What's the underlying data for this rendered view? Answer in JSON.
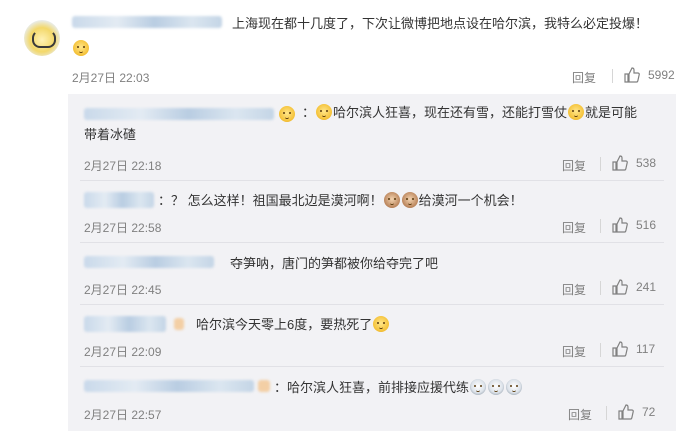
{
  "main_comment": {
    "text": "上海现在都十几度了，下次让微博把地点设在哈尔滨，我特么必定投爆！",
    "time": "2月27日 22:03",
    "reply_label": "回复",
    "likes": "5992"
  },
  "replies": [
    {
      "prefix": "：",
      "text_a": "哈尔滨人狂喜，现在还有雪，还能打雪仗",
      "text_b": "就是可能",
      "text_line2": "带着冰碴",
      "time": "2月27日 22:18",
      "reply_label": "回复",
      "likes": "538"
    },
    {
      "prefix": "：",
      "text_a": "？ 怎么这样！祖国最北边是漠河啊！",
      "text_b": "给漠河一个机会！",
      "time": "2月27日 22:58",
      "reply_label": "回复",
      "likes": "516"
    },
    {
      "text": "夺笋呐，唐门的笋都被你给夺完了吧",
      "time": "2月27日 22:45",
      "reply_label": "回复",
      "likes": "241"
    },
    {
      "text": "哈尔滨今天零上6度，要热死了",
      "time": "2月27日 22:09",
      "reply_label": "回复",
      "likes": "117"
    },
    {
      "prefix": "：",
      "text": "哈尔滨人狂喜，前排接应援代练",
      "time": "2月27日 22:57",
      "reply_label": "回复",
      "likes": "72"
    }
  ],
  "icons": {
    "like": "thumbs-up-icon",
    "emoji": "doge-emoji-icon",
    "avatar": "user-avatar"
  },
  "colors": {
    "text": "#333333",
    "meta": "#808080",
    "sub_bg": "#f2f2f5",
    "blur": "#c9d9ea"
  }
}
